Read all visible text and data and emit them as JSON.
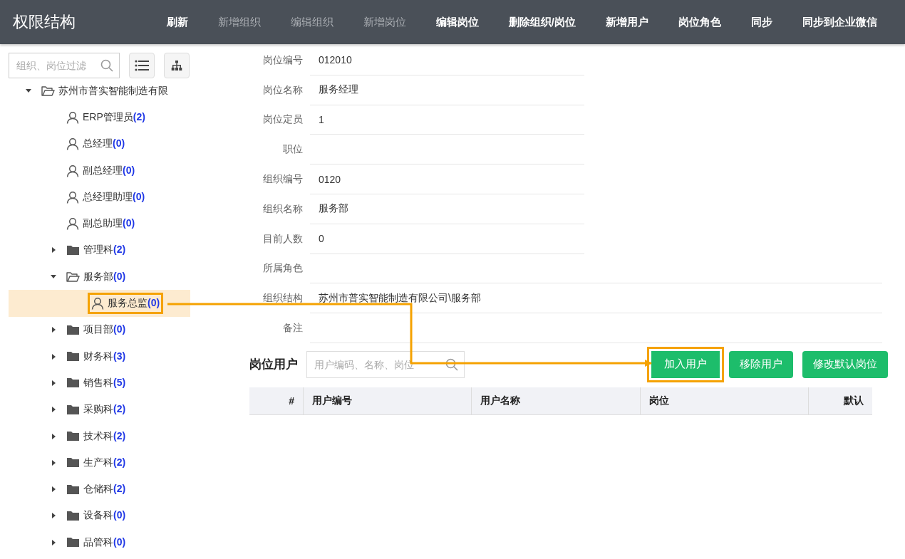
{
  "header": {
    "title": "权限结构",
    "actions": [
      {
        "label": "刷新",
        "disabled": false
      },
      {
        "label": "新增组织",
        "disabled": true
      },
      {
        "label": "编辑组织",
        "disabled": true
      },
      {
        "label": "新增岗位",
        "disabled": true
      },
      {
        "label": "编辑岗位",
        "disabled": false
      },
      {
        "label": "删除组织/岗位",
        "disabled": false
      },
      {
        "label": "新增用户",
        "disabled": false
      },
      {
        "label": "岗位角色",
        "disabled": false
      },
      {
        "label": "同步",
        "disabled": false
      },
      {
        "label": "同步到企业微信",
        "disabled": false
      }
    ]
  },
  "sidebar": {
    "search": {
      "placeholder": "组织、岗位过滤"
    },
    "tree": [
      {
        "label": "苏州市普实智能制造有限",
        "kind": "folder",
        "expanded": true,
        "selected": false,
        "highlighted": false,
        "children": [
          {
            "label": "ERP管理员",
            "count": "(2)",
            "kind": "user",
            "selected": false,
            "highlighted": false
          },
          {
            "label": "总经理",
            "count": "(0)",
            "kind": "user",
            "selected": false,
            "highlighted": false
          },
          {
            "label": "副总经理",
            "count": "(0)",
            "kind": "user",
            "selected": false,
            "highlighted": false
          },
          {
            "label": "总经理助理",
            "count": "(0)",
            "kind": "user",
            "selected": false,
            "highlighted": false
          },
          {
            "label": "副总助理",
            "count": "(0)",
            "kind": "user",
            "selected": false,
            "highlighted": false
          },
          {
            "label": "管理科",
            "count": "(2)",
            "kind": "folder",
            "expanded": false,
            "selected": false,
            "highlighted": false
          },
          {
            "label": "服务部",
            "count": "(0)",
            "kind": "folder",
            "expanded": true,
            "selected": false,
            "highlighted": false,
            "children": [
              {
                "label": "服务总监",
                "count": "(0)",
                "kind": "user",
                "selected": true,
                "highlighted": true
              }
            ]
          },
          {
            "label": "项目部",
            "count": "(0)",
            "kind": "folder",
            "expanded": false,
            "selected": false,
            "highlighted": false
          },
          {
            "label": "财务科",
            "count": "(3)",
            "kind": "folder",
            "expanded": false,
            "selected": false,
            "highlighted": false
          },
          {
            "label": "销售科",
            "count": "(5)",
            "kind": "folder",
            "expanded": false,
            "selected": false,
            "highlighted": false
          },
          {
            "label": "采购科",
            "count": "(2)",
            "kind": "folder",
            "expanded": false,
            "selected": false,
            "highlighted": false
          },
          {
            "label": "技术科",
            "count": "(2)",
            "kind": "folder",
            "expanded": false,
            "selected": false,
            "highlighted": false
          },
          {
            "label": "生产科",
            "count": "(2)",
            "kind": "folder",
            "expanded": false,
            "selected": false,
            "highlighted": false
          },
          {
            "label": "仓储科",
            "count": "(2)",
            "kind": "folder",
            "expanded": false,
            "selected": false,
            "highlighted": false
          },
          {
            "label": "设备科",
            "count": "(0)",
            "kind": "folder",
            "expanded": false,
            "selected": false,
            "highlighted": false
          },
          {
            "label": "品管科",
            "count": "(0)",
            "kind": "folder",
            "expanded": false,
            "selected": false,
            "highlighted": false
          }
        ]
      }
    ]
  },
  "form": {
    "fields": [
      {
        "label": "岗位编号",
        "value": "012010",
        "wide": false
      },
      {
        "label": "岗位名称",
        "value": "服务经理",
        "wide": false
      },
      {
        "label": "岗位定员",
        "value": "1",
        "wide": false
      },
      {
        "label": "职位",
        "wide": false
      },
      {
        "label": "组织编号",
        "value": "0120",
        "wide": false
      },
      {
        "label": "组织名称",
        "value": "服务部",
        "wide": false
      },
      {
        "label": "目前人数",
        "value": "0",
        "wide": false
      },
      {
        "label": "所属角色",
        "wide": true
      },
      {
        "label": "组织结构",
        "value": "苏州市普实智能制造有限公司\\服务部",
        "wide": true
      },
      {
        "label": "备注",
        "wide": true
      }
    ]
  },
  "post_users": {
    "title": "岗位用户",
    "search": {
      "placeholder": "用户编码、名称、岗位"
    },
    "buttons": [
      {
        "label": "加入用户",
        "highlighted": true
      },
      {
        "label": "移除用户",
        "highlighted": false
      },
      {
        "label": "修改默认岗位",
        "highlighted": false
      }
    ],
    "table": {
      "columns": [
        {
          "label": "#"
        },
        {
          "label": "用户编号"
        },
        {
          "label": "用户名称"
        },
        {
          "label": "岗位"
        },
        {
          "label": "默认"
        }
      ]
    }
  }
}
